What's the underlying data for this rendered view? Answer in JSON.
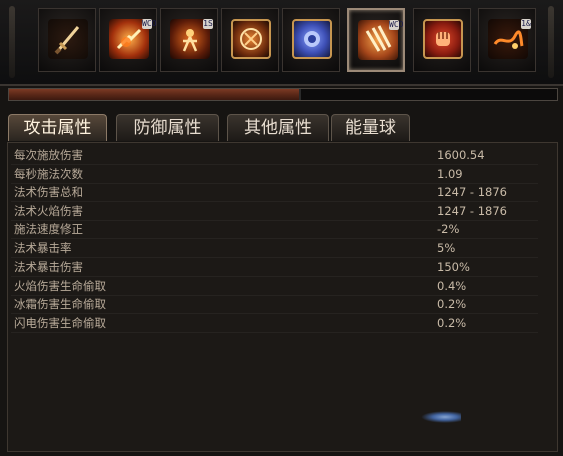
{
  "skills": [
    {
      "icon": "sword-icon",
      "tag": ""
    },
    {
      "icon": "fire-burst-icon",
      "tag": "WCO"
    },
    {
      "icon": "fire-warrior-icon",
      "tag": "1S"
    },
    {
      "icon": "meteor-shield-icon",
      "tag": ""
    },
    {
      "icon": "blue-rune-shield-icon",
      "tag": ""
    },
    {
      "icon": "fire-trails-icon",
      "tag": "WCO"
    },
    {
      "icon": "fire-fist-icon",
      "tag": ""
    },
    {
      "icon": "fire-whip-icon",
      "tag": "1&"
    }
  ],
  "active_skill_index": 5,
  "progress": {
    "fraction": 0.53
  },
  "tabs": [
    {
      "label": "攻击属性"
    },
    {
      "label": "防御属性"
    },
    {
      "label": "其他属性"
    },
    {
      "label": "能量球"
    }
  ],
  "active_tab": 0,
  "stats": [
    {
      "label": "每次施放伤害",
      "value": "1600.54"
    },
    {
      "label": "每秒施法次数",
      "value": "1.09"
    },
    {
      "label": "法术伤害总和",
      "value": "1247 - 1876"
    },
    {
      "label": "法术火焰伤害",
      "value": "1247 - 1876"
    },
    {
      "label": "施法速度修正",
      "value": "-2%"
    },
    {
      "label": "法术暴击率",
      "value": "5%"
    },
    {
      "label": "法术暴击伤害",
      "value": "150%"
    },
    {
      "label": "火焰伤害生命偷取",
      "value": "0.4%"
    },
    {
      "label": "冰霜伤害生命偷取",
      "value": "0.2%"
    },
    {
      "label": "闪电伤害生命偷取",
      "value": "0.2%"
    }
  ],
  "colors": {
    "fire": "#e8641b",
    "ember": "#f4b24a",
    "frost": "#3d5fd1",
    "progress_fill": "#6a2f1d",
    "label_text": "#b8aa99",
    "value_text": "#c9bba8"
  }
}
